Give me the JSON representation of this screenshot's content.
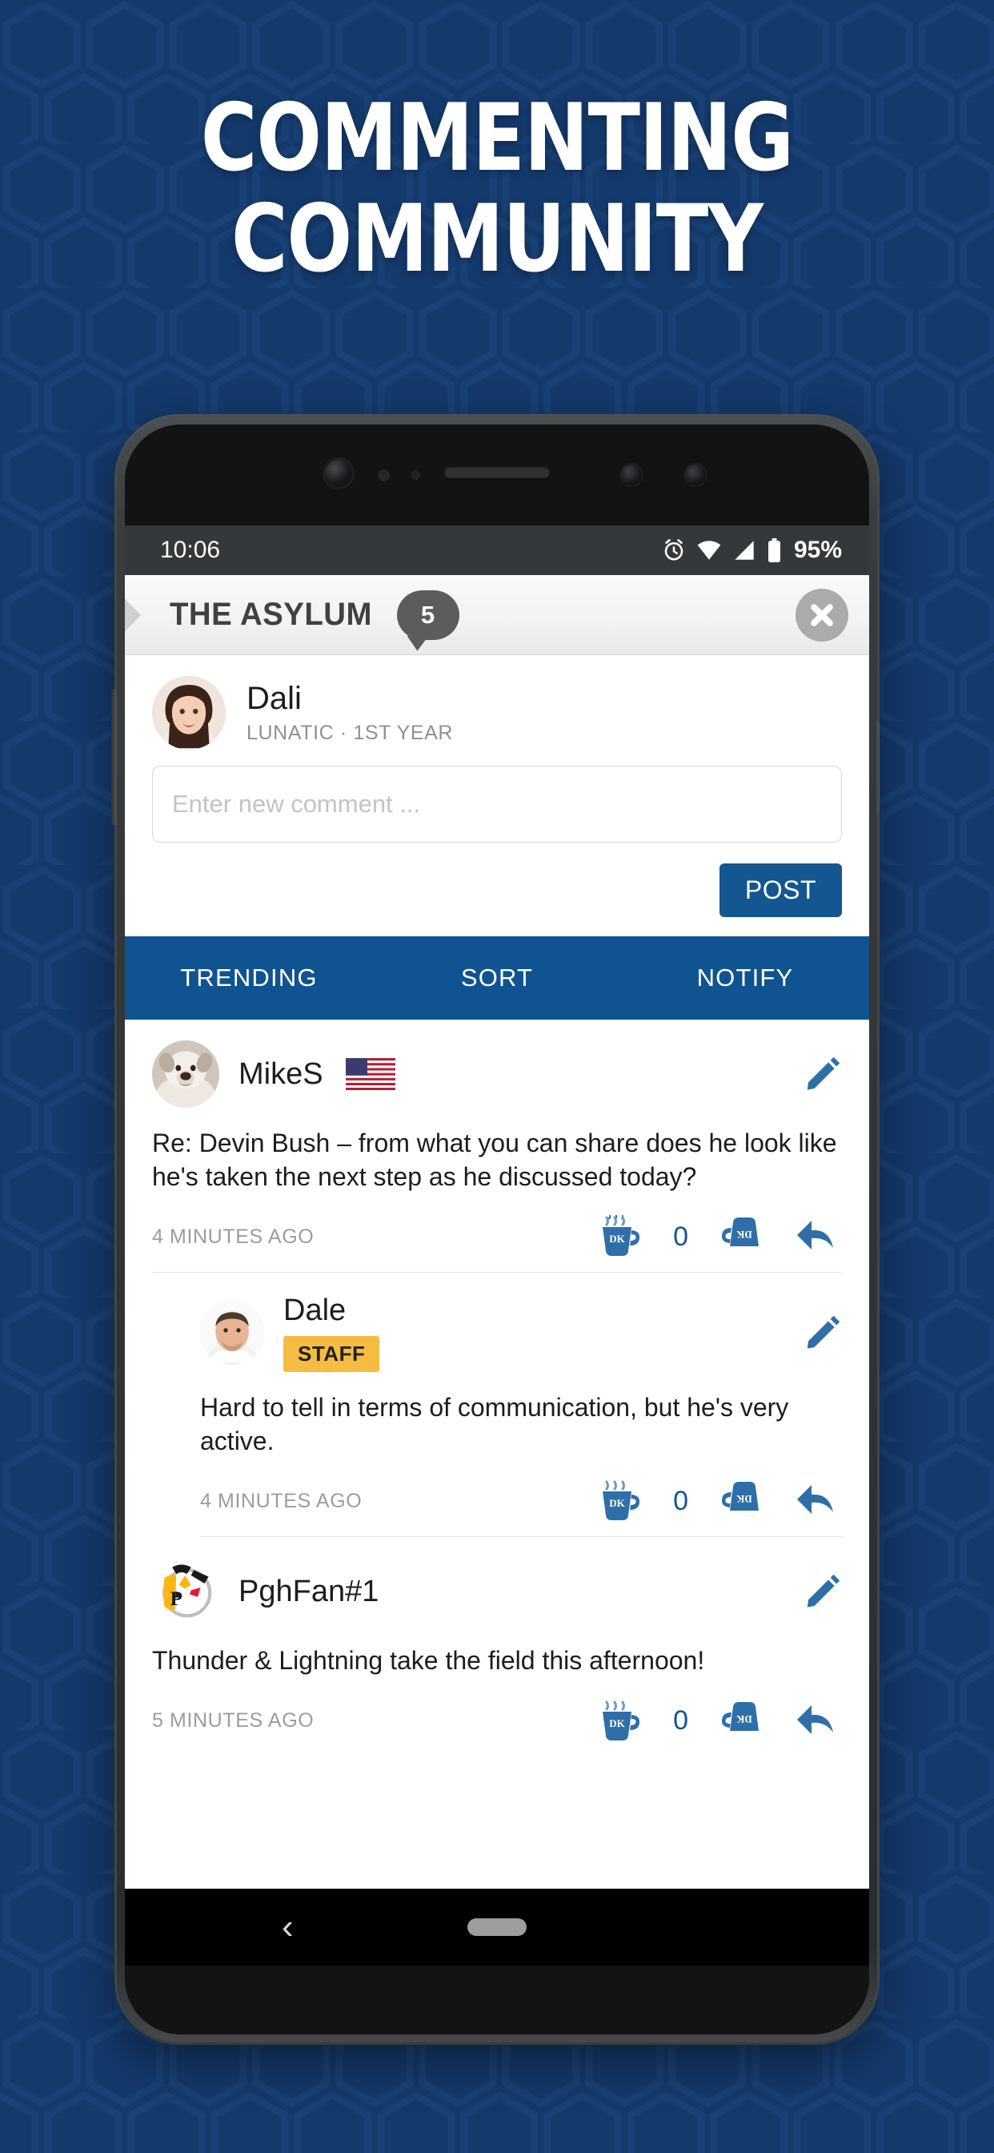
{
  "promo": {
    "headline_line1": "COMMENTING",
    "headline_line2": "COMMUNITY",
    "background_color": "#14396b",
    "accent_color": "#0f5490"
  },
  "status_bar": {
    "time": "10:06",
    "battery_percent": "95%",
    "icons": [
      "alarm-icon",
      "wifi-icon",
      "signal-icon",
      "battery-icon"
    ]
  },
  "app_header": {
    "title": "THE ASYLUM",
    "unread_count": "5",
    "close_label": "close-icon"
  },
  "profile": {
    "name": "Dali",
    "meta": "LUNATIC · 1ST YEAR"
  },
  "compose": {
    "placeholder": "Enter new comment ...",
    "value": "",
    "post_label": "POST"
  },
  "tabs": [
    {
      "label": "TRENDING"
    },
    {
      "label": "SORT"
    },
    {
      "label": "NOTIFY"
    }
  ],
  "comments": [
    {
      "author": "MikeS",
      "flag": "us-flag-icon",
      "badge": "",
      "body": "Re: Devin Bush – from what you can share does he look like he's taken the next step as he discussed today?",
      "time": "4 MINUTES AGO",
      "votes": "0",
      "is_reply": false
    },
    {
      "author": "Dale",
      "flag": "",
      "badge": "STAFF",
      "body": "Hard to tell in terms of communication, but he's very active.",
      "time": "4 MINUTES AGO",
      "votes": "0",
      "is_reply": true
    },
    {
      "author": "PghFan#1",
      "flag": "",
      "badge": "",
      "body": "Thunder & Lightning take the field this afternoon!",
      "time": "5 MINUTES AGO",
      "votes": "0",
      "is_reply": false
    }
  ],
  "reactions": {
    "upvote_label": "DK",
    "downvote_label": "DK"
  },
  "nav_bar": {
    "back_glyph": "‹"
  }
}
